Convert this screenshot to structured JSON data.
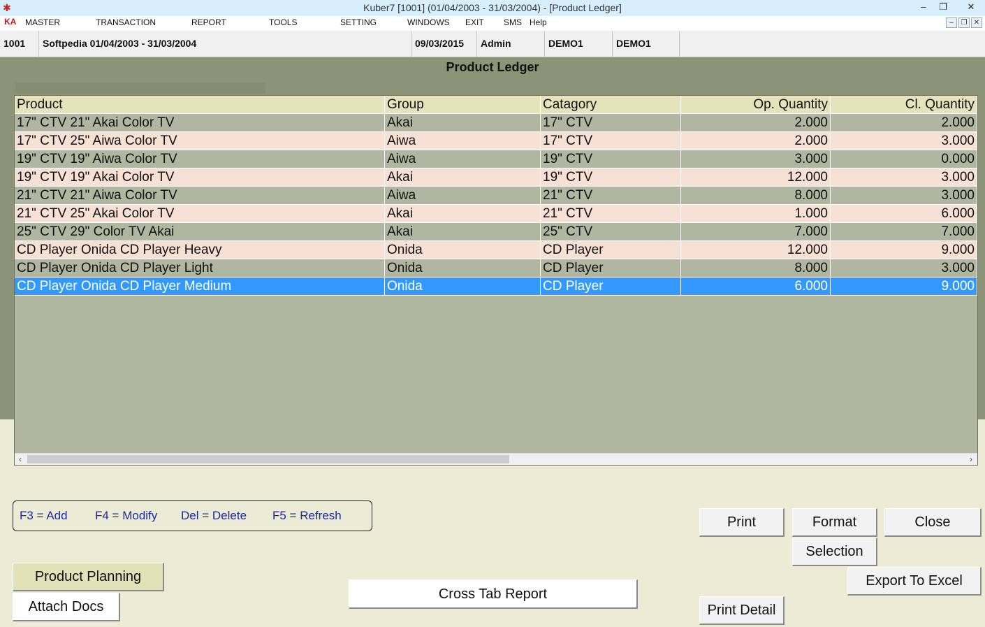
{
  "window": {
    "title": "Kuber7 [1001] (01/04/2003 - 31/03/2004) - [Product Ledger]",
    "minimize_glyph": "–",
    "restore_glyph": "❐",
    "close_glyph": "✕"
  },
  "menu": {
    "logo": "KA",
    "items": [
      "MASTER",
      "TRANSACTION",
      "REPORT",
      "TOOLS",
      "SETTING",
      "WINDOWS",
      "EXIT",
      "SMS",
      "Help"
    ],
    "mdi_minimize": "–",
    "mdi_restore": "❐",
    "mdi_close": "✕"
  },
  "info": {
    "company_code": "1001",
    "company_period": "Softpedia  01/04/2003 - 31/03/2004",
    "date": "09/03/2015",
    "user": "Admin",
    "db1": "DEMO1",
    "db2": "DEMO1"
  },
  "panel": {
    "title": "Product Ledger"
  },
  "grid": {
    "columns": [
      "Product",
      "Group",
      "Catagory",
      "Op. Quantity",
      "Cl. Quantity"
    ],
    "rows": [
      [
        "17\" CTV  21\" Akai Color TV",
        "Akai",
        "17\" CTV",
        "2.000",
        "2.000"
      ],
      [
        "17\" CTV  25\" Aiwa Color TV",
        "Aiwa",
        "17\" CTV",
        "2.000",
        "3.000"
      ],
      [
        "19\" CTV  19\" Aiwa Color TV",
        "Aiwa",
        "19\" CTV",
        "3.000",
        "0.000"
      ],
      [
        "19\" CTV  19\" Akai Color TV",
        "Akai",
        "19\" CTV",
        "12.000",
        "3.000"
      ],
      [
        "21\" CTV  21\" Aiwa Color TV",
        "Aiwa",
        "21\" CTV",
        "8.000",
        "3.000"
      ],
      [
        "21\" CTV  25\" Akai Color TV",
        "Akai",
        "21\" CTV",
        "1.000",
        "6.000"
      ],
      [
        "25\" CTV  29\" Color TV Akai",
        "Akai",
        "25\" CTV",
        "7.000",
        "7.000"
      ],
      [
        "CD Player  Onida CD Player Heavy",
        "Onida",
        "CD Player",
        "12.000",
        "9.000"
      ],
      [
        "CD Player  Onida CD Player Light",
        "Onida",
        "CD Player",
        "8.000",
        "3.000"
      ],
      [
        "CD Player  Onida CD Player Medium",
        "Onida",
        "CD Player",
        "6.000",
        "9.000"
      ]
    ],
    "selected_row": 9,
    "scroll_left": "‹",
    "scroll_right": "›"
  },
  "shortcuts": {
    "add": "F3 =  Add",
    "modify": "F4 = Modify",
    "delete": "Del =  Delete",
    "refresh": "F5 =  Refresh"
  },
  "buttons": {
    "print": "Print",
    "format": "Format",
    "close": "Close",
    "selection": "Selection",
    "export_excel": "Export To Excel",
    "print_detail": "Print Detail",
    "product_planning": "Product Planning",
    "attach_docs": "Attach Docs",
    "cross_tab_report": "Cross Tab Report"
  }
}
